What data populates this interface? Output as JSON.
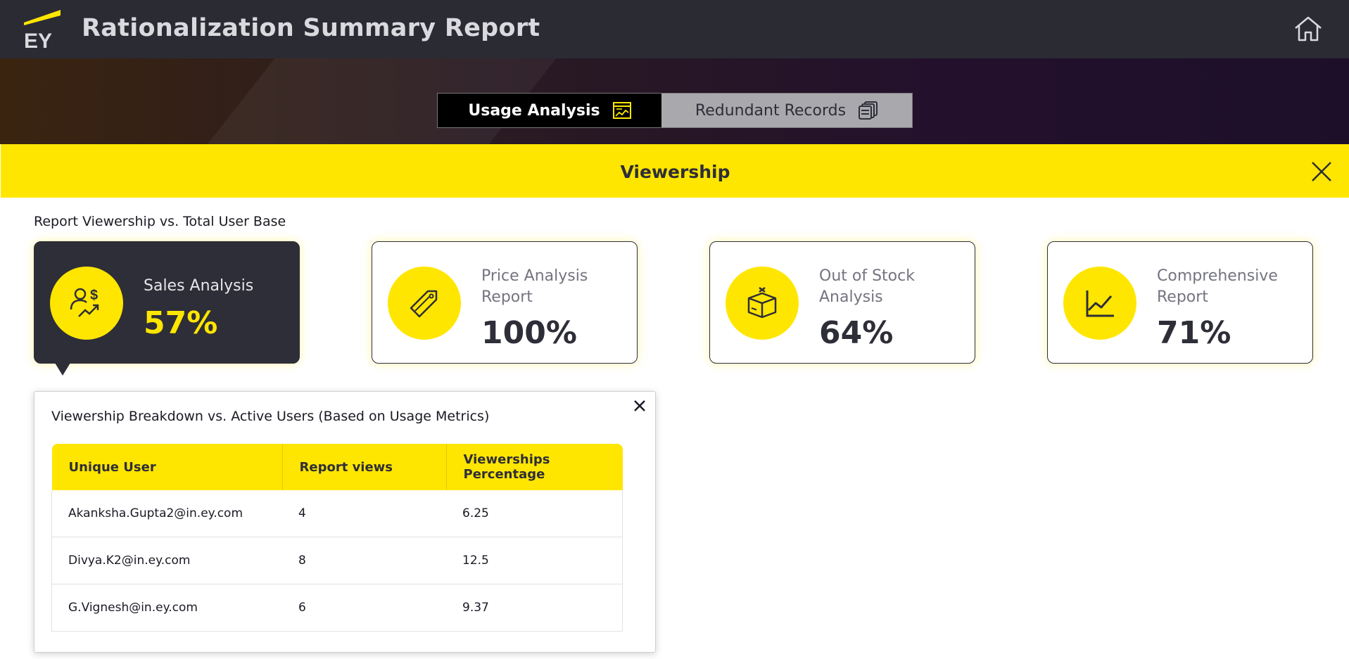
{
  "header": {
    "logo_text": "EY",
    "title": "Rationalization Summary Report"
  },
  "tabs": [
    {
      "label": "Usage Analysis",
      "icon": "chart-window-icon",
      "active": true
    },
    {
      "label": "Redundant Records",
      "icon": "stacked-cards-icon",
      "active": false
    }
  ],
  "panel": {
    "title": "Viewership",
    "section_label": "Report Viewership vs. Total User Base"
  },
  "cards": [
    {
      "label": "Sales Analysis",
      "value": "57%",
      "icon": "user-dollar-trend-icon"
    },
    {
      "label": "Price Analysis Report",
      "value": "100%",
      "icon": "price-tag-icon"
    },
    {
      "label": "Out of Stock Analysis",
      "value": "64%",
      "icon": "empty-box-icon"
    },
    {
      "label": "Comprehensive Report",
      "value": "71%",
      "icon": "line-chart-icon"
    }
  ],
  "popup": {
    "title": "Viewership Breakdown vs. Active Users (Based on Usage Metrics)",
    "columns": [
      "Unique User",
      "Report views",
      "Viewerships Percentage"
    ],
    "rows": [
      [
        "Akanksha.Gupta2@in.ey.com",
        "4",
        "6.25"
      ],
      [
        "Divya.K2@in.ey.com",
        "8",
        "12.5"
      ],
      [
        "G.Vignesh@in.ey.com",
        "6",
        "9.37"
      ]
    ]
  },
  "colors": {
    "brand_yellow": "#ffe600",
    "dark": "#2e2e38",
    "topbar": "#2b2b34"
  }
}
